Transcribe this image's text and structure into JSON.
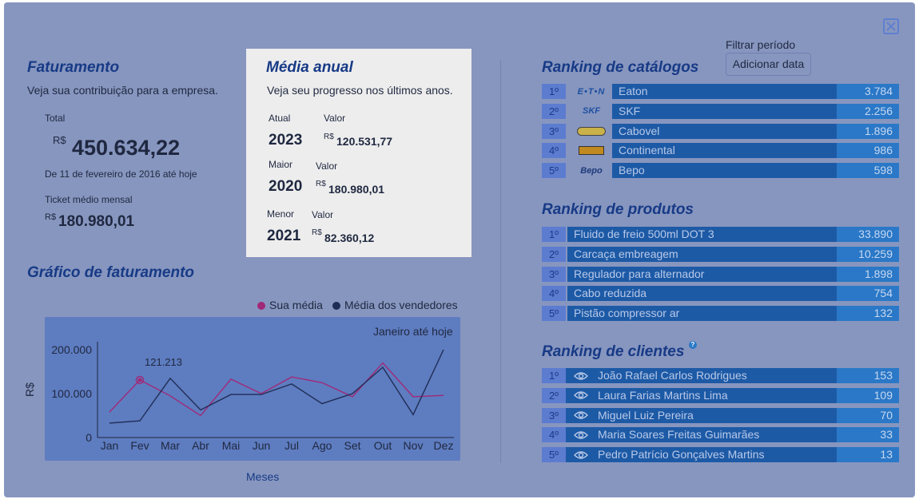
{
  "colors": {
    "overlay": "#8796bf",
    "title": "#173a86",
    "rank_name_bg": "#1d5aa6",
    "rank_value_bg": "#2a78c7",
    "series_sua_media": "#a02a78",
    "series_vendedores": "#1f2d55"
  },
  "faturamento": {
    "title": "Faturamento",
    "subtitle": "Veja sua contribuição para a empresa.",
    "total_label": "Total",
    "currency": "R$",
    "total_value": "450.634,22",
    "period": "De 11 de fevereiro de 2016 até hoje",
    "ticket_label": "Ticket médio mensal",
    "ticket_value": "180.980,01"
  },
  "media_anual": {
    "title": "Média anual",
    "subtitle": "Veja seu progresso nos últimos anos.",
    "rows": [
      {
        "label": "Atual",
        "year": "2023",
        "value_label": "Valor",
        "currency": "R$",
        "value": "120.531,77"
      },
      {
        "label": "Maior",
        "year": "2020",
        "value_label": "Valor",
        "currency": "R$",
        "value": "180.980,01"
      },
      {
        "label": "Menor",
        "year": "2021",
        "value_label": "Valor",
        "currency": "R$",
        "value": "82.360,12"
      }
    ]
  },
  "filter": {
    "label": "Filtrar período",
    "button": "Adicionar data"
  },
  "ranking_catalogos": {
    "title": "Ranking de catálogos",
    "rows": [
      {
        "pos": "1º",
        "logo_icon": "eaton-logo",
        "name": "Eaton",
        "value": "3.784"
      },
      {
        "pos": "2º",
        "logo_icon": "skf-logo",
        "name": "SKF",
        "value": "2.256"
      },
      {
        "pos": "3º",
        "logo_icon": "cabovel-logo",
        "name": "Cabovel",
        "value": "1.896"
      },
      {
        "pos": "4º",
        "logo_icon": "continental-logo",
        "name": "Continental",
        "value": "986"
      },
      {
        "pos": "5º",
        "logo_icon": "bepo-logo",
        "name": "Bepo",
        "value": "598"
      }
    ]
  },
  "ranking_produtos": {
    "title": "Ranking de produtos",
    "rows": [
      {
        "pos": "1º",
        "name": "Fluido de freio 500ml DOT 3",
        "value": "33.890"
      },
      {
        "pos": "2º",
        "name": "Carcaça embreagem",
        "value": "10.259"
      },
      {
        "pos": "3º",
        "name": "Regulador para alternador",
        "value": "1.898"
      },
      {
        "pos": "4º",
        "name": "Cabo reduzida",
        "value": "754"
      },
      {
        "pos": "5º",
        "name": "Pistão compressor ar",
        "value": "132"
      }
    ]
  },
  "ranking_clientes": {
    "title": "Ranking de clientes",
    "help_icon": "help-icon",
    "rows": [
      {
        "pos": "1º",
        "name": "João Rafael Carlos Rodrigues",
        "value": "153"
      },
      {
        "pos": "2º",
        "name": "Laura Farias Martins Lima",
        "value": "109"
      },
      {
        "pos": "3º",
        "name": "Miguel Luiz Pereira",
        "value": "70"
      },
      {
        "pos": "4º",
        "name": "Maria Soares Freitas Guimarães",
        "value": "33"
      },
      {
        "pos": "5º",
        "name": "Pedro Patrício Gonçalves Martins",
        "value": "13"
      }
    ]
  },
  "grafico": {
    "title": "Gráfico de faturamento",
    "period": "Janeiro até hoje",
    "highlight_label": "121.213"
  },
  "chart_data": {
    "type": "line",
    "categories": [
      "Jan",
      "Fev",
      "Mar",
      "Abr",
      "Mai",
      "Jun",
      "Jul",
      "Ago",
      "Set",
      "Out",
      "Nov",
      "Dez"
    ],
    "series": [
      {
        "name": "Sua média",
        "values": [
          58000,
          131000,
          95000,
          50000,
          133000,
          100000,
          138000,
          125000,
          93000,
          170000,
          93000,
          96000
        ]
      },
      {
        "name": "Média dos vendedores",
        "values": [
          33000,
          38000,
          135000,
          63000,
          98000,
          98000,
          122000,
          77000,
          100000,
          160000,
          52000,
          200000
        ]
      }
    ],
    "highlight": {
      "series": "Sua média",
      "category": "Fev",
      "value": 121213
    },
    "yticks": [
      "200.000",
      "100.000",
      "0"
    ],
    "ylim": [
      0,
      220000
    ],
    "xlabel": "Meses",
    "ylabel": "R$",
    "legend": "top-right"
  }
}
